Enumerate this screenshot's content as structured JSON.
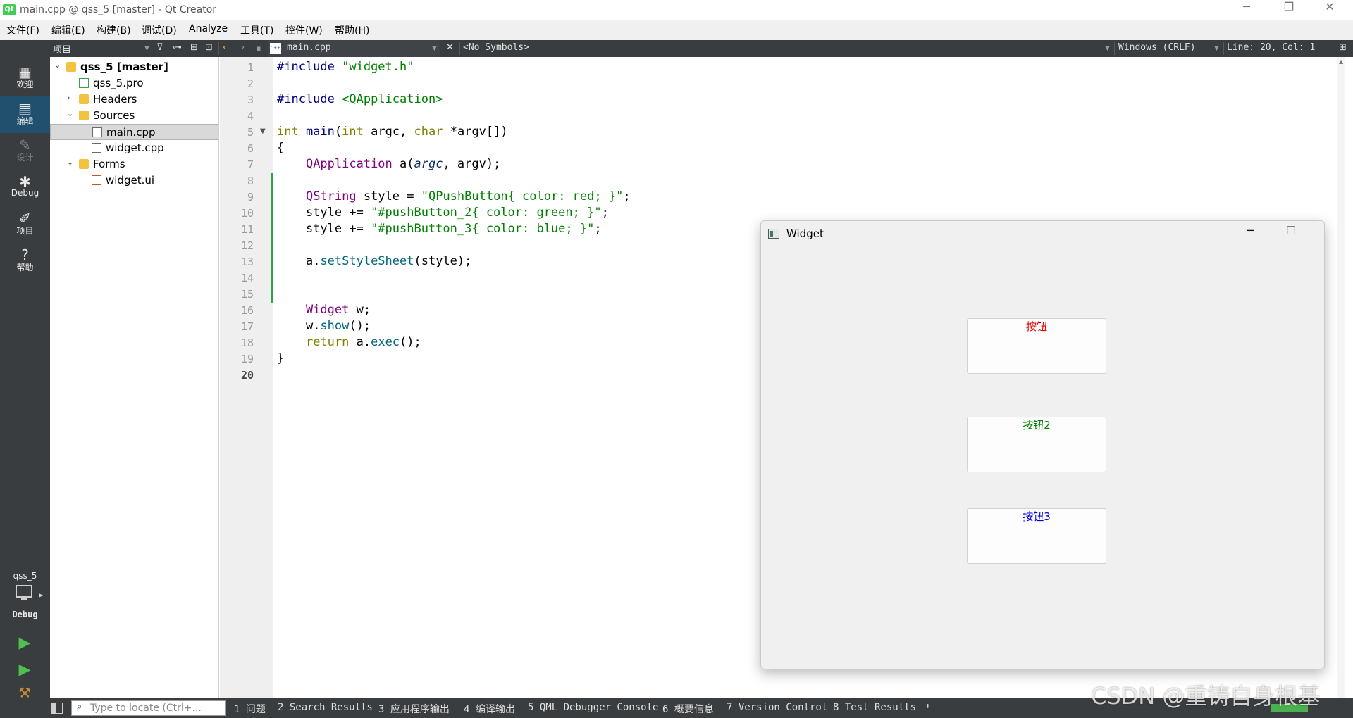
{
  "window": {
    "title": "main.cpp @ qss_5 [master] - Qt Creator",
    "logo_text": "Qt",
    "minimize_glyph": "─",
    "restore_glyph": "❐",
    "close_glyph": "✕"
  },
  "menu": [
    "文件(F)",
    "编辑(E)",
    "构建(B)",
    "调试(D)",
    "Analyze",
    "工具(T)",
    "控件(W)",
    "帮助(H)"
  ],
  "toolbar": {
    "panel_title": "项目",
    "doc_name": "main.cpp",
    "doc_icon_text": "C++",
    "symbols": "<No Symbols>",
    "encoding": "Windows (CRLF)",
    "position": "Line: 20, Col: 1"
  },
  "modes": [
    {
      "label": "欢迎",
      "icon": "grid-icon",
      "glyph": "▦",
      "state": "normal"
    },
    {
      "label": "编辑",
      "icon": "edit-document-icon",
      "glyph": "▤",
      "state": "active"
    },
    {
      "label": "设计",
      "icon": "pencil-icon",
      "glyph": "✎",
      "state": "disabled"
    },
    {
      "label": "Debug",
      "icon": "bug-icon",
      "glyph": "✱",
      "state": "normal"
    },
    {
      "label": "项目",
      "icon": "wrench-icon",
      "glyph": "✐",
      "state": "normal"
    },
    {
      "label": "帮助",
      "icon": "help-icon",
      "glyph": "?",
      "state": "normal"
    }
  ],
  "kit": {
    "project": "qss_5",
    "config": "Debug"
  },
  "tree": [
    {
      "label": "qss_5 [master]",
      "depth": 0,
      "expand": "open",
      "icon": "project",
      "bold": true,
      "selected": false
    },
    {
      "label": "qss_5.pro",
      "depth": 1,
      "expand": "none",
      "icon": "pro",
      "bold": false,
      "selected": false
    },
    {
      "label": "Headers",
      "depth": 1,
      "expand": "closed",
      "icon": "folder",
      "bold": false,
      "selected": false
    },
    {
      "label": "Sources",
      "depth": 1,
      "expand": "open",
      "icon": "folder",
      "bold": false,
      "selected": false
    },
    {
      "label": "main.cpp",
      "depth": 2,
      "expand": "none",
      "icon": "cpp",
      "bold": false,
      "selected": true
    },
    {
      "label": "widget.cpp",
      "depth": 2,
      "expand": "none",
      "icon": "cpp",
      "bold": false,
      "selected": false
    },
    {
      "label": "Forms",
      "depth": 1,
      "expand": "open",
      "icon": "folder",
      "bold": false,
      "selected": false
    },
    {
      "label": "widget.ui",
      "depth": 2,
      "expand": "none",
      "icon": "ui",
      "bold": false,
      "selected": false
    }
  ],
  "code": {
    "current_line": 20,
    "fold_line": 5,
    "changed_lines": [
      8,
      15
    ],
    "lines": [
      [
        [
          "pp",
          "#include "
        ],
        [
          "str",
          "\"widget.h\""
        ]
      ],
      [],
      [
        [
          "pp",
          "#include "
        ],
        [
          "str",
          "<QApplication>"
        ]
      ],
      [],
      [
        [
          "kw",
          "int"
        ],
        [
          "",
          " "
        ],
        [
          "pp",
          "main"
        ],
        [
          "",
          "("
        ],
        [
          "kw",
          "int"
        ],
        [
          "",
          " argc, "
        ],
        [
          "kw",
          "char"
        ],
        [
          "",
          " *argv[])"
        ]
      ],
      [
        [
          "",
          "{"
        ]
      ],
      [
        [
          "",
          "    "
        ],
        [
          "ty",
          "QApplication"
        ],
        [
          "",
          " a("
        ],
        [
          "it",
          "argc"
        ],
        [
          "",
          ", argv);"
        ]
      ],
      [],
      [
        [
          "",
          "    "
        ],
        [
          "ty",
          "QString"
        ],
        [
          "",
          " style = "
        ],
        [
          "str",
          "\"QPushButton{ color: red; }\""
        ],
        [
          "",
          ";"
        ]
      ],
      [
        [
          "",
          "    style += "
        ],
        [
          "str",
          "\"#pushButton_2{ color: green; }\""
        ],
        [
          "",
          ";"
        ]
      ],
      [
        [
          "",
          "    style += "
        ],
        [
          "str",
          "\"#pushButton_3{ color: blue; }\""
        ],
        [
          "",
          ";"
        ]
      ],
      [],
      [
        [
          "",
          "    a."
        ],
        [
          "fn",
          "setStyleSheet"
        ],
        [
          "",
          "(style);"
        ]
      ],
      [],
      [],
      [
        [
          "",
          "    "
        ],
        [
          "ty",
          "Widget"
        ],
        [
          "",
          " w;"
        ]
      ],
      [
        [
          "",
          "    w."
        ],
        [
          "fn",
          "show"
        ],
        [
          "",
          "();"
        ]
      ],
      [
        [
          "",
          "    "
        ],
        [
          "kw",
          "return"
        ],
        [
          "",
          " a."
        ],
        [
          "fn",
          "exec"
        ],
        [
          "",
          "();"
        ]
      ],
      [
        [
          "",
          "}"
        ]
      ],
      []
    ]
  },
  "widget_window": {
    "title": "Widget",
    "minimize_glyph": "─",
    "maximize_glyph": "☐",
    "close_glyph": "✕",
    "buttons": [
      {
        "label": "按钮",
        "color": "#e00000"
      },
      {
        "label": "按钮2",
        "color": "#008000"
      },
      {
        "label": "按钮3",
        "color": "#0000e0"
      }
    ]
  },
  "statusbar": {
    "locator_placeholder": "Type to locate (Ctrl+...",
    "panes": [
      "1 问题",
      "2 Search Results",
      "3 应用程序输出",
      "4 编译输出",
      "5 QML Debugger Console",
      "6 概要信息",
      "7 Version Control",
      "8 Test Results"
    ]
  },
  "watermark": "CSDN @重铸自身根基"
}
